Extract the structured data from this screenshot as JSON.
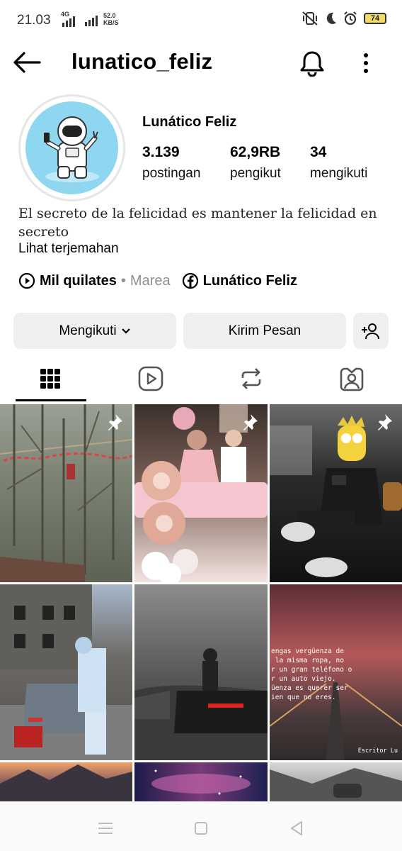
{
  "status_bar": {
    "time": "21.03",
    "network_type": "4G",
    "speed_value": "52.0",
    "speed_unit": "KB/S",
    "battery": "74"
  },
  "header": {
    "username": "lunatico_feliz",
    "back_icon": "arrow-left-icon",
    "bell_icon": "bell-icon",
    "more_icon": "more-vertical-icon"
  },
  "profile": {
    "display_name": "Lunático Feliz",
    "stats": [
      {
        "value": "3.139",
        "label": "postingan"
      },
      {
        "value": "62,9RB",
        "label": "pengikut"
      },
      {
        "value": "34",
        "label": "mengikuti"
      }
    ],
    "bio": "El secreto de la felicidad es mantener la felicidad en secreto",
    "translate_link": "Lihat terjemahan",
    "music_title": "Mil quilates",
    "music_separator": "•",
    "music_artist": "Marea",
    "facebook_link": "Lunático Feliz"
  },
  "actions": {
    "following_label": "Mengikuti",
    "message_label": "Kirim Pesan"
  },
  "tabs": [
    {
      "icon": "grid-icon",
      "active": true
    },
    {
      "icon": "reels-icon",
      "active": false
    },
    {
      "icon": "repost-icon",
      "active": false
    },
    {
      "icon": "tagged-icon",
      "active": false
    }
  ],
  "quote_post": {
    "text": "engas vergüenza de\n la misma ropa, no\nr un gran teléfono o\nr un auto viejo.\nüenza es querer ser\nien que no eres.",
    "author": "Escritor Lu"
  },
  "colors": {
    "button_bg": "#efefef",
    "secondary_text": "#8e8e8e",
    "avatar_bg": "#8fd6f0"
  }
}
